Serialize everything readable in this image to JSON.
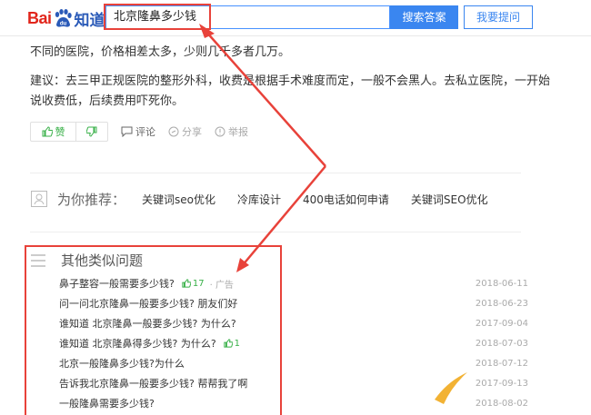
{
  "header": {
    "logo": {
      "part1": "Bai",
      "part2": "知道"
    },
    "search": {
      "value": "北京隆鼻多少钱"
    },
    "search_button": "搜索答案",
    "ask_button": "我要提问"
  },
  "answer": {
    "lines": [
      "不同的医院，价格相差太多，少则几千多者几万。",
      "建议：去三甲正规医院的整形外科，收费是根据手术难度而定，一般不会黑人。去私立医院，一开始",
      "说收费低，后续费用吓死你。"
    ],
    "actions": {
      "like": "赞",
      "comment": "评论",
      "share": "分享",
      "report": "举报"
    }
  },
  "recommend": {
    "title": "为你推荐：",
    "links": [
      "关键词seo优化",
      "冷库设计",
      "400电话如何申请",
      "关键词SEO优化"
    ]
  },
  "similar": {
    "title": "其他类似问题",
    "questions": [
      {
        "text": "鼻子整容一般需要多少钱?",
        "likes": "17",
        "ad": "广告",
        "date": "2018-06-11"
      },
      {
        "text": "问一问北京隆鼻一般要多少钱? 朋友们好",
        "date": "2018-06-23"
      },
      {
        "text": "谁知道 北京隆鼻一般要多少钱? 为什么?",
        "date": "2017-09-04"
      },
      {
        "text": "谁知道 北京隆鼻得多少钱? 为什么?",
        "likes": "1",
        "date": "2018-07-03"
      },
      {
        "text": "北京一般隆鼻多少钱?为什么",
        "date": "2018-07-12"
      },
      {
        "text": "告诉我北京隆鼻一般要多少钱? 帮帮我了啊",
        "date": "2017-09-13"
      },
      {
        "text": "一般隆鼻需要多少钱?",
        "date": "2018-08-02"
      }
    ]
  },
  "colors": {
    "accent": "#3a86f0",
    "annotation": "#e8423a",
    "like_green": "#38b048"
  }
}
